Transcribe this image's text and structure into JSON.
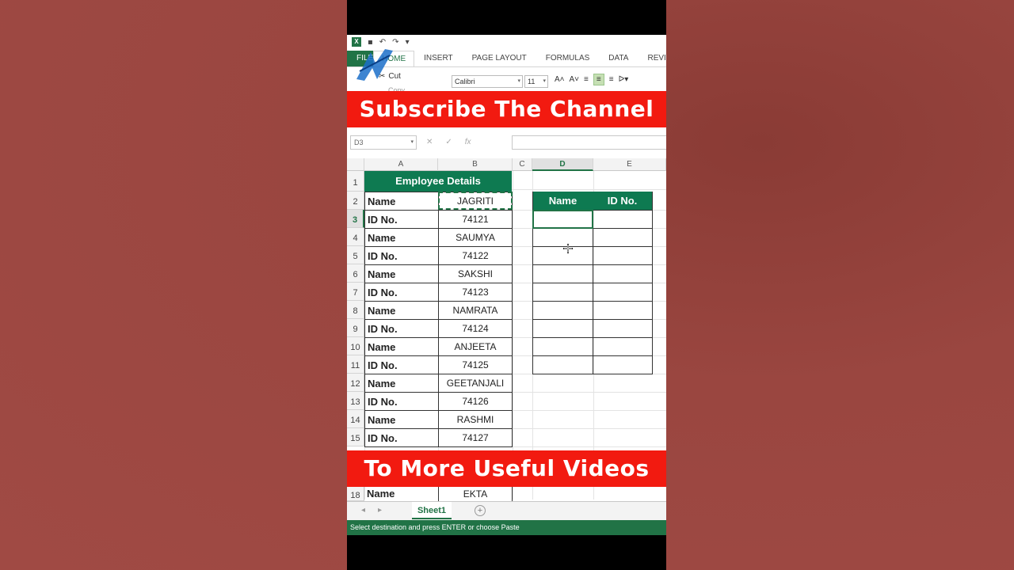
{
  "qat": {
    "logo": "X",
    "undo": "↶",
    "redo": "↷",
    "more": "▾"
  },
  "ribbon": {
    "tabs": [
      "HOME",
      "INSERT",
      "PAGE LAYOUT",
      "FORMULAS",
      "DATA",
      "REVIEW"
    ],
    "active_tab": "HOME",
    "file_tab": "FILE",
    "cut_label": "Cut",
    "copy_label": "Copy",
    "font_name": "Calibri",
    "font_size": "11"
  },
  "banners": {
    "top": "Subscribe The Channel",
    "bottom": "To More Useful Videos"
  },
  "formula_bar": {
    "name_box": "D3",
    "value": ""
  },
  "columns": [
    "A",
    "B",
    "C",
    "D",
    "E"
  ],
  "selected_column": "D",
  "rows": [
    "1",
    "2",
    "3",
    "4",
    "5",
    "6",
    "7",
    "8",
    "9",
    "10",
    "11",
    "12",
    "13",
    "14",
    "15",
    "18"
  ],
  "selected_row": "3",
  "sheet": {
    "title": "Employee Details",
    "records": [
      {
        "label": "Name",
        "value": "JAGRITI"
      },
      {
        "label": "ID No.",
        "value": "74121"
      },
      {
        "label": "Name",
        "value": "SAUMYA"
      },
      {
        "label": "ID No.",
        "value": "74122"
      },
      {
        "label": "Name",
        "value": "SAKSHI"
      },
      {
        "label": "ID No.",
        "value": "74123"
      },
      {
        "label": "Name",
        "value": "NAMRATA"
      },
      {
        "label": "ID No.",
        "value": "74124"
      },
      {
        "label": "Name",
        "value": "ANJEETA"
      },
      {
        "label": "ID No.",
        "value": "74125"
      },
      {
        "label": "Name",
        "value": "GEETANJALI"
      },
      {
        "label": "ID No.",
        "value": "74126"
      },
      {
        "label": "Name",
        "value": "RASHMI"
      },
      {
        "label": "ID No.",
        "value": "74127"
      }
    ],
    "bottom_record": {
      "label": "Name",
      "value": "EKTA"
    },
    "output_headers": [
      "Name",
      "ID No."
    ]
  },
  "sheet_tab": "Sheet1",
  "status_text": "Select destination and press ENTER or choose Paste",
  "colors": {
    "excel_green": "#217346",
    "header_green": "#0e7a51",
    "banner_red": "#f21a10"
  }
}
